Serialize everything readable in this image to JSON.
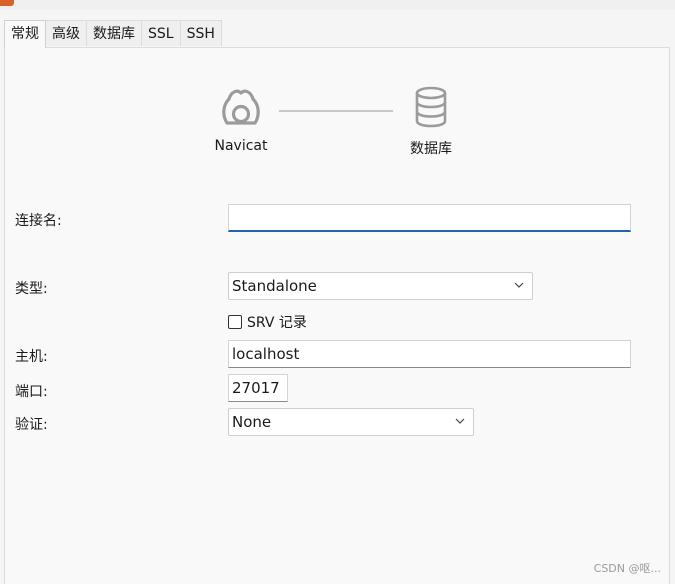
{
  "tabs": [
    {
      "label": "常规",
      "active": true
    },
    {
      "label": "高级",
      "active": false
    },
    {
      "label": "数据库",
      "active": false
    },
    {
      "label": "SSL",
      "active": false
    },
    {
      "label": "SSH",
      "active": false
    }
  ],
  "diagram": {
    "left_label": "Navicat",
    "left_icon": "navicat-logo-icon",
    "right_label": "数据库",
    "right_icon": "database-icon"
  },
  "form": {
    "connection_name": {
      "label": "连接名:",
      "value": ""
    },
    "type": {
      "label": "类型:",
      "value": "Standalone"
    },
    "srv": {
      "label": "SRV 记录",
      "checked": false
    },
    "host": {
      "label": "主机:",
      "value": "localhost"
    },
    "port": {
      "label": "端口:",
      "value": "27017"
    },
    "auth": {
      "label": "验证:",
      "value": "None"
    }
  },
  "watermark": "CSDN @呕...",
  "colors": {
    "focus_underline": "#1f63b8",
    "title_icon": "#d9622b"
  }
}
